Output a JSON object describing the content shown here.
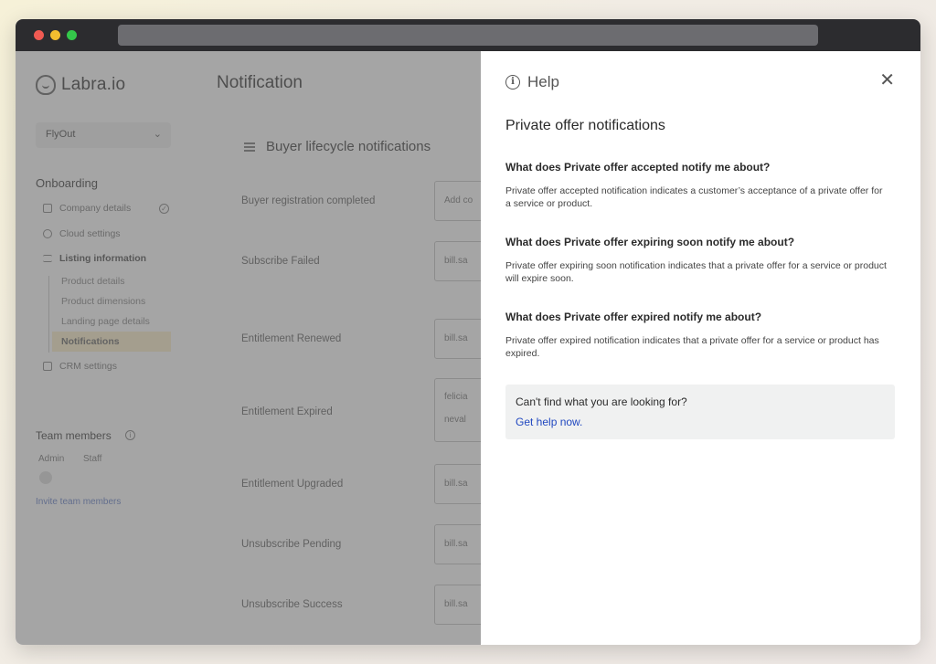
{
  "sidebar": {
    "brand": "Labra.io",
    "product_select": "FlyOut",
    "onboarding_title": "Onboarding",
    "items": [
      {
        "label": "Company details"
      },
      {
        "label": "Cloud settings"
      },
      {
        "label": "Listing information"
      },
      {
        "label": "CRM settings"
      }
    ],
    "sub_items": [
      {
        "label": "Product details"
      },
      {
        "label": "Product dimensions"
      },
      {
        "label": "Landing page details"
      },
      {
        "label": "Notifications"
      }
    ],
    "team": {
      "title": "Team members",
      "admin_label": "Admin",
      "staff_label": "Staff",
      "invite_label": "Invite team members"
    }
  },
  "main": {
    "title": "Notification",
    "card_title": "Buyer lifecycle notifications",
    "rows": [
      {
        "label": "Buyer registration completed",
        "value": "Add co"
      },
      {
        "label": "Subscribe Failed",
        "value": "bill.sa"
      },
      {
        "label": "Entitlement Renewed",
        "value": "bill.sa"
      },
      {
        "label": "Entitlement Expired",
        "value": "felicia",
        "value2": "neval"
      },
      {
        "label": "Entitlement Upgraded",
        "value": "bill.sa"
      },
      {
        "label": "Unsubscribe Pending",
        "value": "bill.sa"
      },
      {
        "label": "Unsubscribe Success",
        "value": "bill.sa"
      }
    ]
  },
  "help": {
    "title": "Help",
    "close_glyph": "✕",
    "subtitle": "Private offer notifications",
    "faqs": [
      {
        "q": "What does Private offer accepted notify me about?",
        "a": "Private offer accepted notification indicates a customer’s acceptance of a private offer for a service or product."
      },
      {
        "q": "What does Private offer expiring soon notify me about?",
        "a": "Private offer expiring soon notification indicates that a private offer for a service or product will expire soon."
      },
      {
        "q": "What does Private offer expired notify me about?",
        "a": "Private offer expired notification indicates that a private offer for a service or product has expired."
      }
    ],
    "box_question": "Can't find what you are looking for?",
    "box_link": "Get help now."
  },
  "colors": {
    "link": "#2148c0",
    "active_nav_bg": "#fdf3d8",
    "titlebar": "#2c2c2f"
  }
}
